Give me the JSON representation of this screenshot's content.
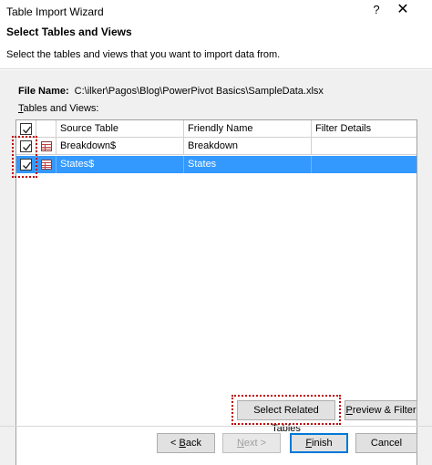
{
  "window": {
    "title": "Table Import Wizard",
    "help": "?",
    "close": "✕"
  },
  "header": {
    "heading": "Select Tables and Views",
    "description": "Select the tables and views that you want to import data from."
  },
  "file": {
    "label": "File Name:",
    "path": "C:\\ilker\\Pagos\\Blog\\PowerPivot Basics\\SampleData.xlsx"
  },
  "tables_label": {
    "accel": "T",
    "rest": "ables and Views:"
  },
  "grid": {
    "columns": [
      "Source Table",
      "Friendly Name",
      "Filter Details"
    ],
    "rows": [
      {
        "source": "Breakdown$",
        "friendly": "Breakdown",
        "filter": "",
        "checked": true,
        "selected": false
      },
      {
        "source": "States$",
        "friendly": "States",
        "filter": "",
        "checked": true,
        "selected": true
      }
    ]
  },
  "buttons": {
    "select_related": "Select Related Tables",
    "preview_accel": "P",
    "preview_rest": "review & Filter",
    "back_prefix": "< ",
    "back_accel": "B",
    "back_rest": "ack",
    "next_accel": "N",
    "next_rest": "ext >",
    "finish_accel": "F",
    "finish_rest": "inish",
    "cancel": "Cancel"
  },
  "colors": {
    "selection": "#3399ff",
    "highlight_border": "#c00000",
    "default_button": "#0078d7"
  }
}
